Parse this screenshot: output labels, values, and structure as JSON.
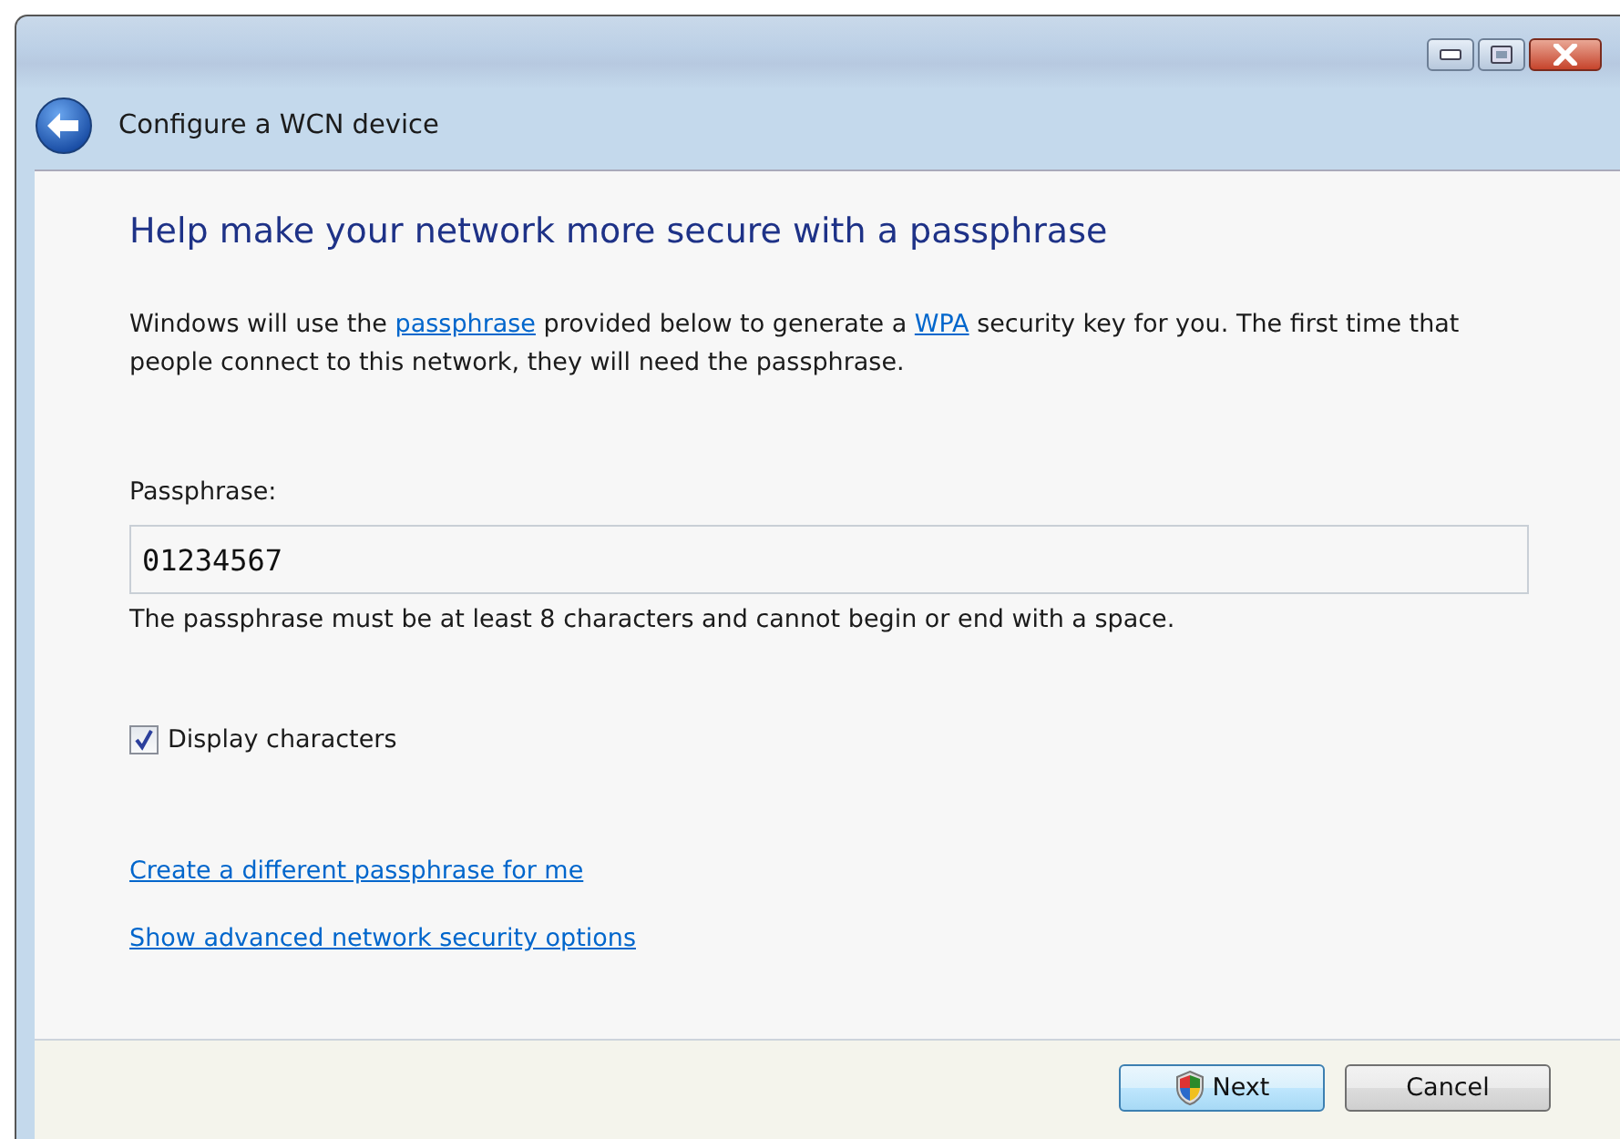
{
  "window": {
    "title": "Configure a WCN device"
  },
  "heading": "Help make your network more secure with a passphrase",
  "description": [
    {
      "kind": "text",
      "text": "Windows will use the "
    },
    {
      "kind": "link",
      "text": "passphrase"
    },
    {
      "kind": "text",
      "text": " provided below to generate a "
    },
    {
      "kind": "link",
      "text": "WPA"
    },
    {
      "kind": "text",
      "text": " security key for you. The first time that people connect to this network, they will need the passphrase."
    }
  ],
  "passphrase": {
    "label": "Passphrase:",
    "value": "01234567",
    "hint": "The passphrase must be at least 8 characters and cannot begin or end with a space."
  },
  "display_characters": {
    "label": "Display characters",
    "checked": true
  },
  "links": [
    "Create a different passphrase for me",
    "Show advanced network security options"
  ],
  "buttons": [
    {
      "label": "Next",
      "kind": "shield"
    },
    {
      "label": "Cancel",
      "kind": "plain"
    }
  ]
}
